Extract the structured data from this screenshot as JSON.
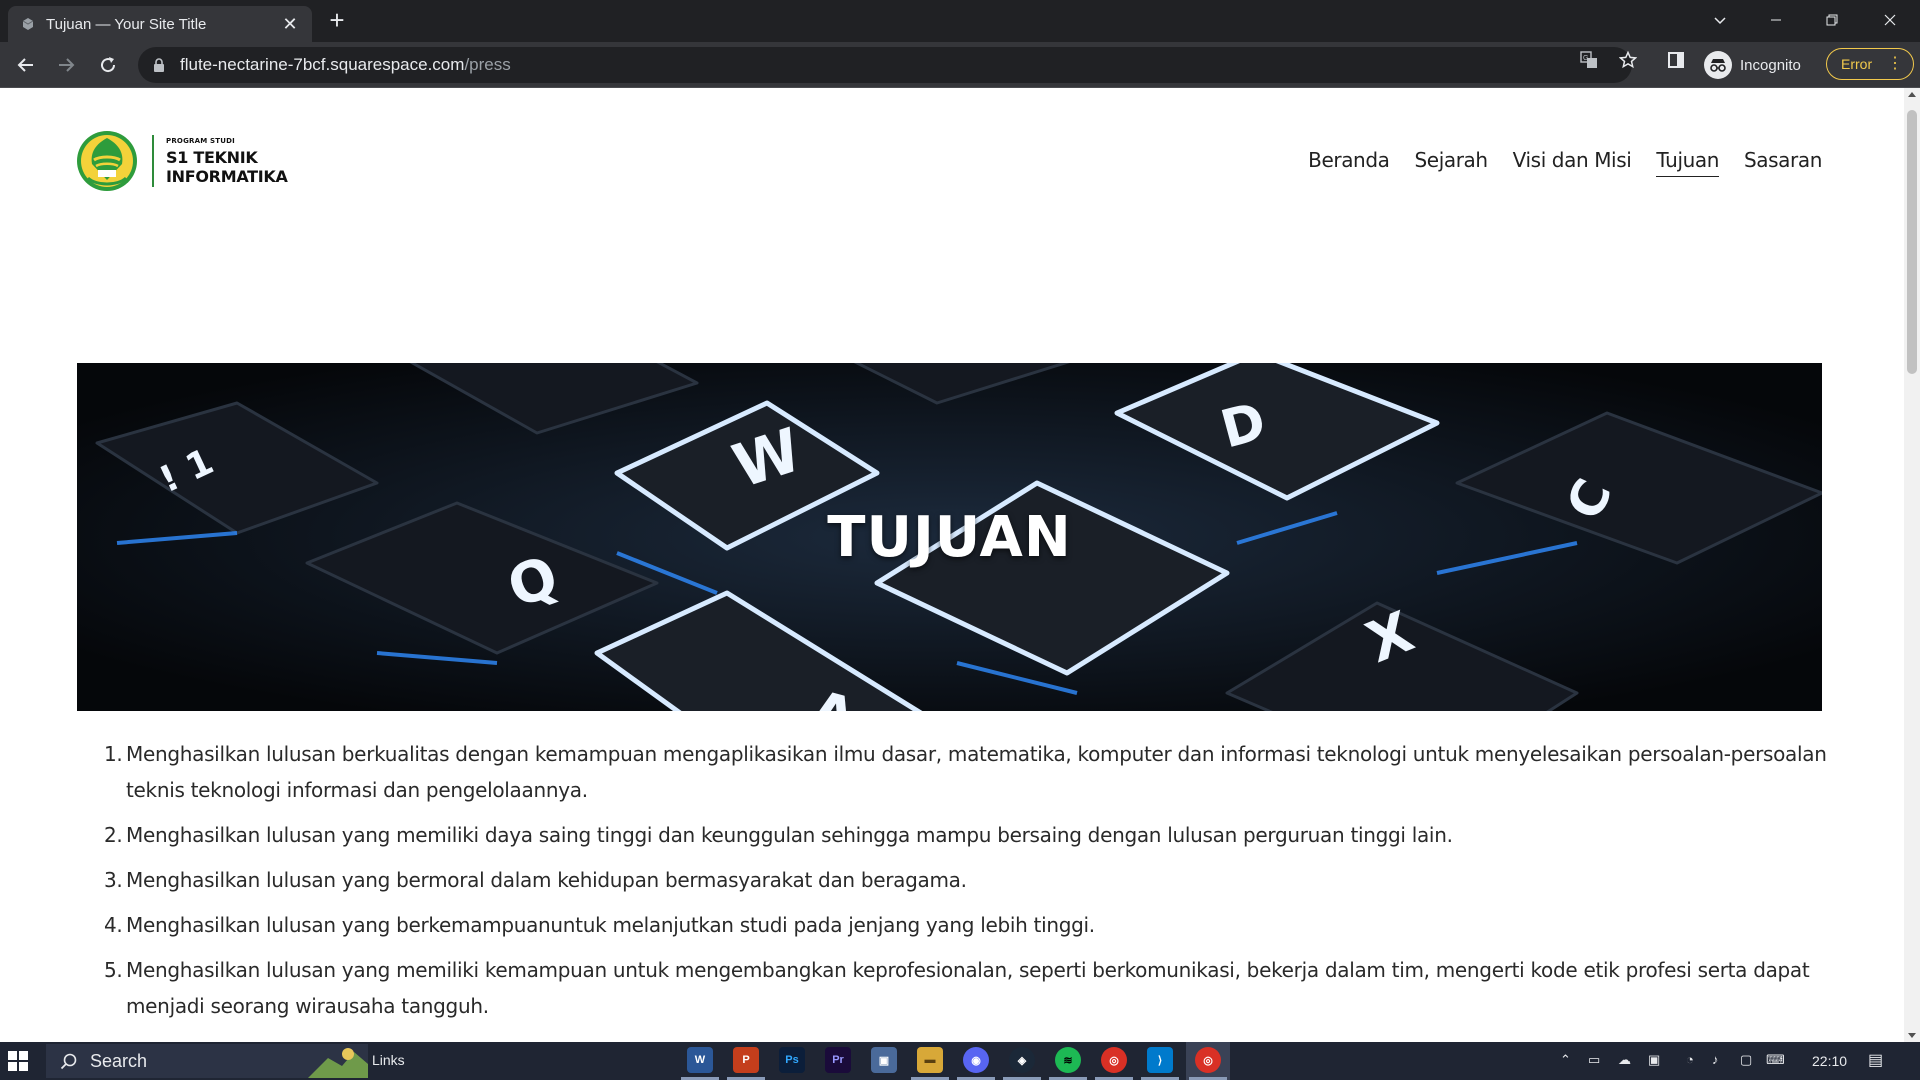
{
  "browser": {
    "tab_title": "Tujuan — Your Site Title",
    "url_host": "flute-nectarine-7bcf.squarespace.com",
    "url_path": "/press",
    "profile_label": "Incognito",
    "error_label": "Error"
  },
  "site": {
    "logo": {
      "small": "PROGRAM STUDI",
      "line1": "S1 TEKNIK",
      "line2": "INFORMATIKA"
    },
    "nav": [
      {
        "label": "Beranda",
        "active": false
      },
      {
        "label": "Sejarah",
        "active": false
      },
      {
        "label": "Visi dan Misi",
        "active": false
      },
      {
        "label": "Tujuan",
        "active": true
      },
      {
        "label": "Sasaran",
        "active": false
      }
    ],
    "hero_title": "TUJUAN",
    "goals": [
      {
        "num": "1.",
        "text": "Menghasilkan lulusan berkualitas dengan kemampuan mengaplikasikan ilmu dasar, matematika, komputer dan informasi teknologi untuk menyelesaikan persoalan-persoalan teknis teknologi informasi dan pengelolaannya."
      },
      {
        "num": "2.",
        "text": "Menghasilkan lulusan yang memiliki daya saing tinggi dan keunggulan sehingga mampu bersaing dengan lulusan perguruan tinggi lain."
      },
      {
        "num": "3.",
        "text": "Menghasilkan lulusan yang bermoral dalam kehidupan bermasyarakat dan beragama."
      },
      {
        "num": "4.",
        "text": "Menghasilkan lulusan yang berkemampuanuntuk melanjutkan studi pada jenjang yang lebih tinggi."
      },
      {
        "num": "5.",
        "text": "Menghasilkan lulusan yang memiliki kemampuan untuk mengembangkan keprofesionalan, seperti berkomunikasi, bekerja dalam tim, mengerti kode etik profesi serta dapat menjadi seorang wirausaha tangguh."
      }
    ]
  },
  "taskbar": {
    "search_label": "Search",
    "links_label": "Links",
    "clock": "22:10",
    "apps": [
      {
        "name": "word",
        "glyph": "W",
        "color": "#2b5797"
      },
      {
        "name": "powerpoint",
        "glyph": "P",
        "color": "#c43e1c"
      },
      {
        "name": "photoshop",
        "glyph": "Ps",
        "color": "#0b1e3a"
      },
      {
        "name": "premiere",
        "glyph": "Pr",
        "color": "#1a0b3a"
      },
      {
        "name": "photos",
        "glyph": "▣",
        "color": "#4a6a9a"
      },
      {
        "name": "file-explorer",
        "glyph": "▬",
        "color": "#d8a838"
      },
      {
        "name": "discord",
        "glyph": "◉",
        "color": "#5865f2"
      },
      {
        "name": "steam",
        "glyph": "◈",
        "color": "#1b2838"
      },
      {
        "name": "spotify",
        "glyph": "≋",
        "color": "#1db954"
      },
      {
        "name": "chrome",
        "glyph": "◎",
        "color": "#d93025"
      },
      {
        "name": "vscode",
        "glyph": "⟩",
        "color": "#007acc"
      },
      {
        "name": "chrome-incognito",
        "glyph": "◎",
        "color": "#d93025"
      }
    ]
  },
  "colors": {
    "accent_green": "#2e8b3a",
    "error_yellow": "#f2c94c",
    "taskbar_bg": "#1f2533"
  }
}
